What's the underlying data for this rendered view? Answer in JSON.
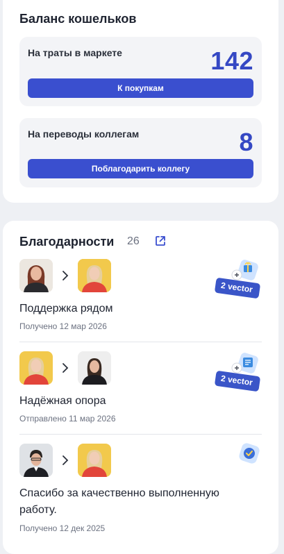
{
  "balance": {
    "title": "Баланс кошельков",
    "wallets": [
      {
        "label": "На траты в маркете",
        "value": "142",
        "button": "К покупкам"
      },
      {
        "label": "На переводы коллегам",
        "value": "8",
        "button": "Поблагодарить коллегу"
      }
    ]
  },
  "thanks": {
    "title": "Благодарности",
    "count": "26",
    "items": [
      {
        "title": "Поддержка рядом",
        "date": "Получено 12 мар 2026",
        "reward": "2 vector",
        "icon": "gift-icon"
      },
      {
        "title": "Надёжная опора",
        "date": "Отправлено 11 мар 2026",
        "reward": "2 vector",
        "icon": "document-icon"
      },
      {
        "title_line1": "Спасибо за качественно выполненную",
        "title_line2": "работу.",
        "date": "Получено 12 дек 2025",
        "icon": "check-badge-icon"
      }
    ]
  },
  "colors": {
    "accent": "#3a4fcf",
    "value": "#3548c4",
    "badge": "#3a55c8"
  }
}
